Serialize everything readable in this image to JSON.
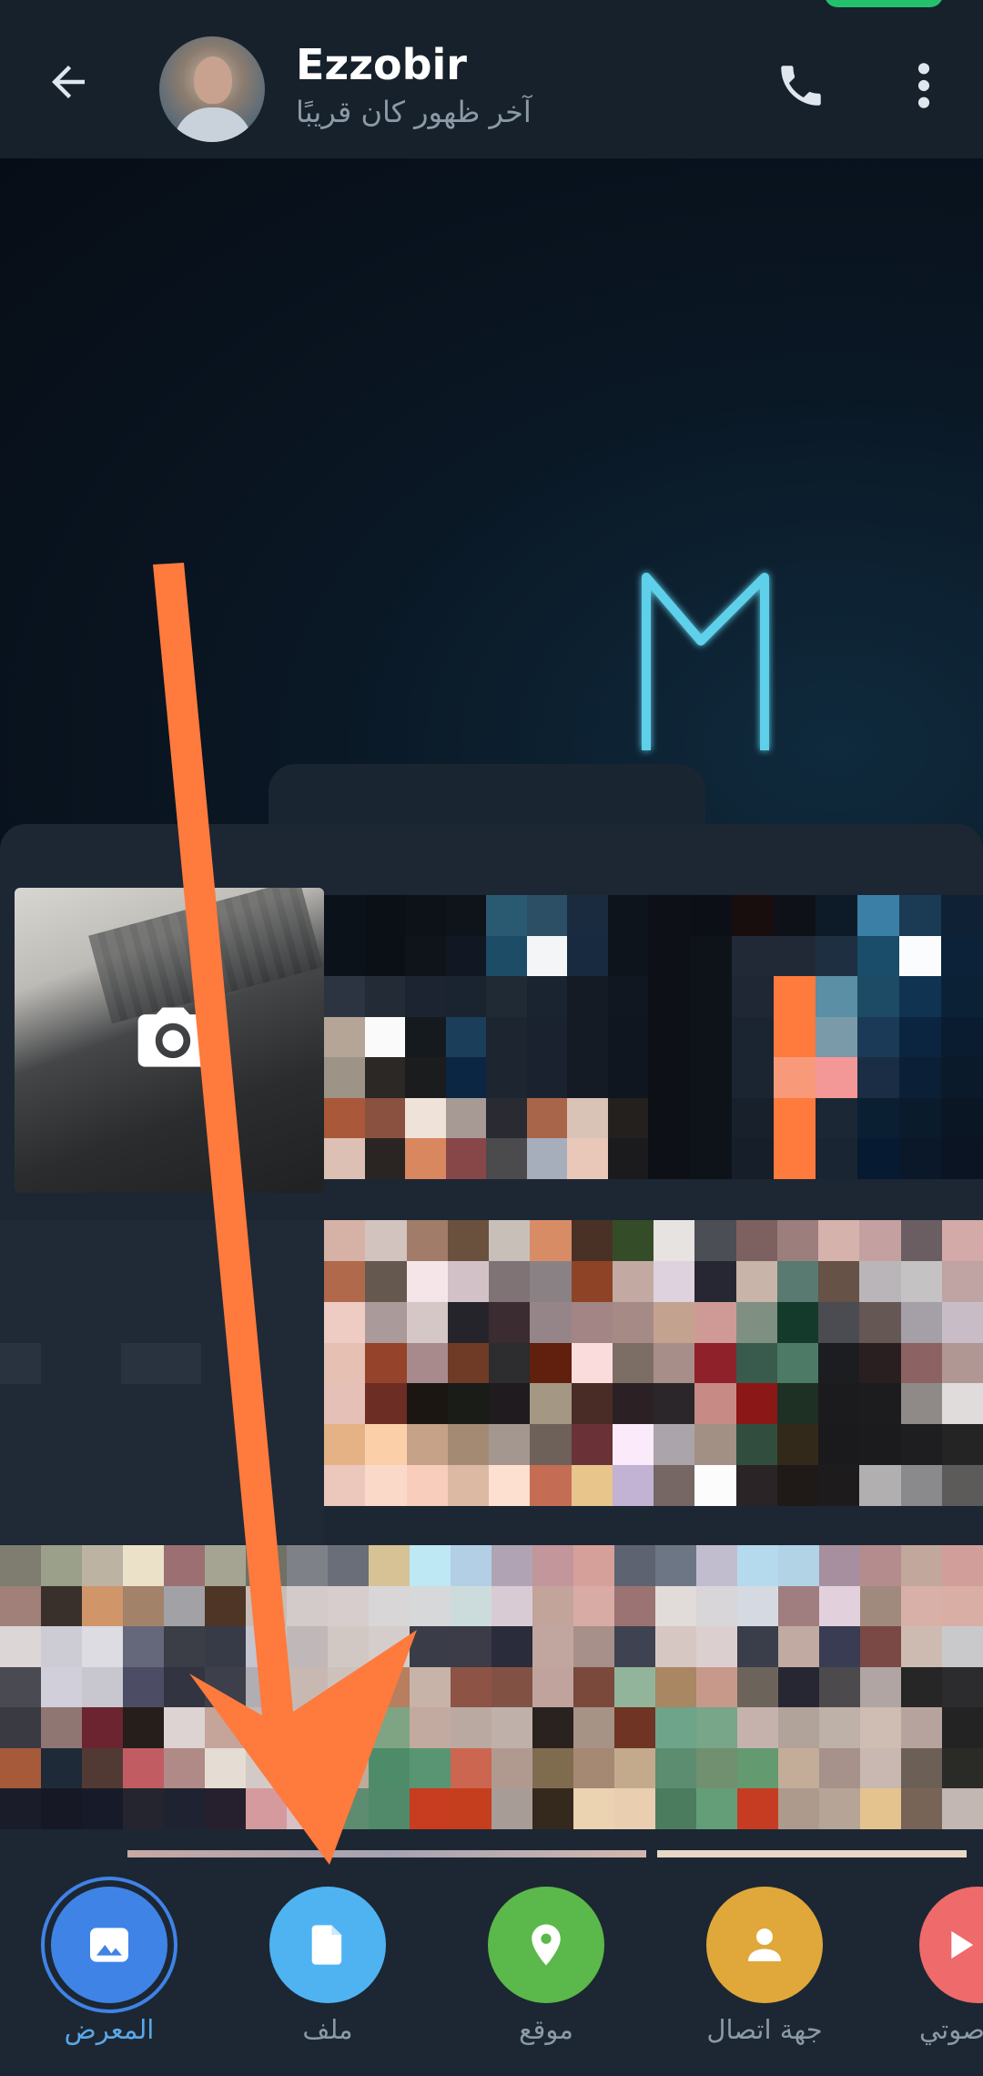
{
  "header": {
    "title": "Ezzobir",
    "subtitle": "آخر ظهور كان قريبًا"
  },
  "icons": {
    "back": "arrow-left-icon",
    "call": "phone-icon",
    "menu": "more-vertical-icon",
    "camera": "camera-icon"
  },
  "attachments": [
    {
      "label": "المعرض",
      "icon": "gallery-icon",
      "color": "#3f83e6",
      "active": true
    },
    {
      "label": "ملف",
      "icon": "file-icon",
      "color": "#4fb3f2",
      "active": false
    },
    {
      "label": "موقع",
      "icon": "location-pin-icon",
      "color": "#5bb84a",
      "active": false
    },
    {
      "label": "جهة اتصال",
      "icon": "contact-icon",
      "color": "#e0a83a",
      "active": false
    },
    {
      "label": "صوتي",
      "icon": "audio-icon",
      "color": "#ef6a6a",
      "active": false
    }
  ],
  "colors": {
    "accent": "#5aa7e7",
    "arrow": "#ff7a3d"
  }
}
